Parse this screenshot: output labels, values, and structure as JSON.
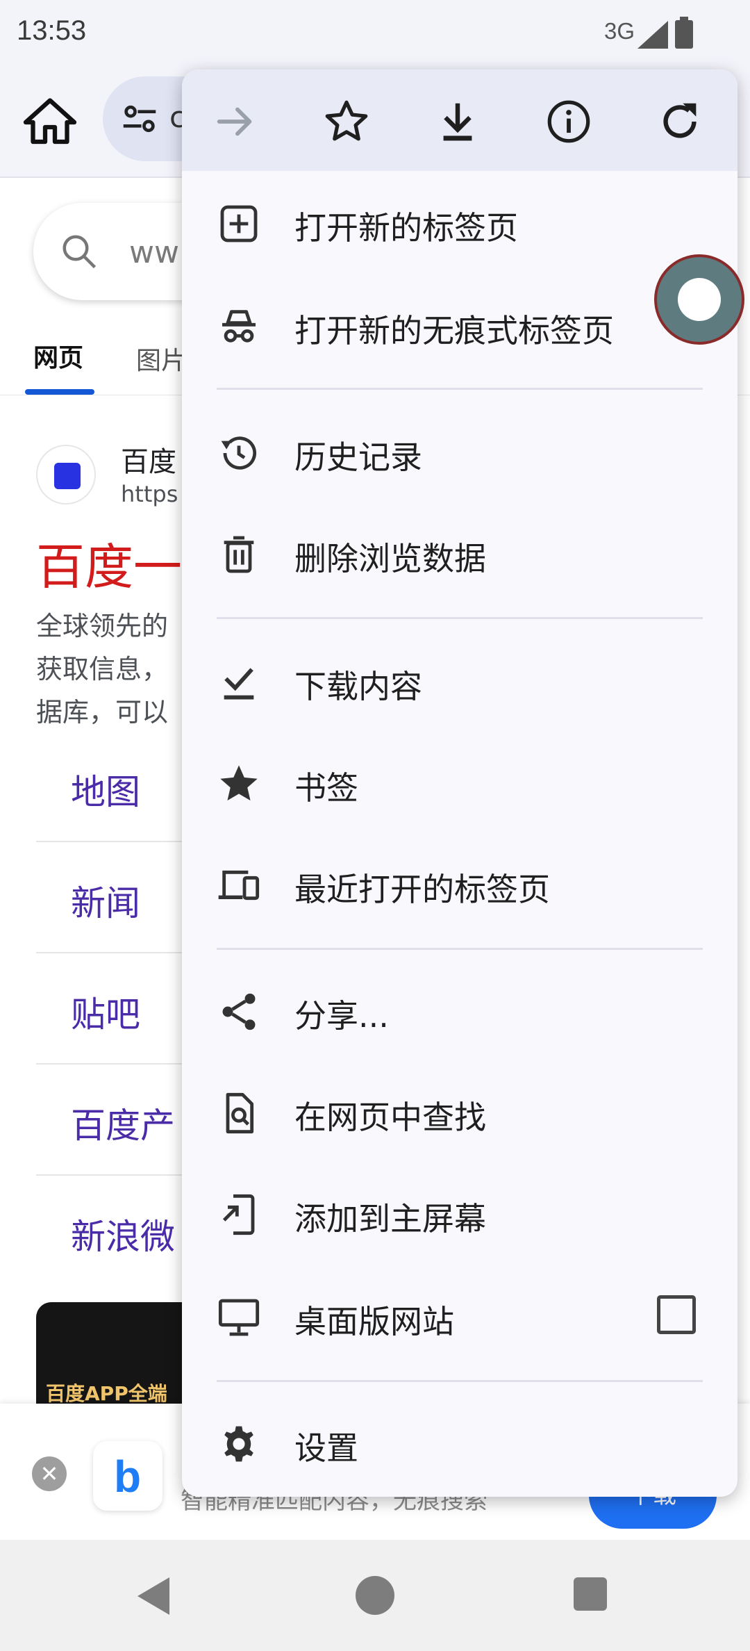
{
  "status_bar": {
    "time": "13:53",
    "network": "3G"
  },
  "toolbar": {
    "omnibox_text": "c"
  },
  "page": {
    "search_text": "ww",
    "tabs": [
      {
        "label": "网页"
      },
      {
        "label": "图片"
      }
    ],
    "result": {
      "site": "百度",
      "url": "https",
      "title": "百度一",
      "snippet_lines": [
        "全球领先的",
        "获取信息，",
        "据库，可以"
      ],
      "sitelinks": [
        "地图",
        "新闻",
        "贴吧",
        "百度产",
        "新浪微"
      ],
      "image_caption": "百度APP全端"
    },
    "banner": {
      "close_symbol": "✕",
      "logo_letter": "b",
      "text": "智能精准匹配内容，无痕搜索",
      "button": "下载"
    }
  },
  "menu": {
    "header_buttons": [
      "forward-icon",
      "bookmark-star-icon",
      "download-icon",
      "info-icon",
      "reload-icon"
    ],
    "items": [
      {
        "icon": "new-tab-icon",
        "label": "打开新的标签页"
      },
      {
        "icon": "incognito-icon",
        "label": "打开新的无痕式标签页"
      },
      {
        "icon": "history-icon",
        "label": "历史记录"
      },
      {
        "icon": "trash-icon",
        "label": "删除浏览数据"
      },
      {
        "icon": "downloads-check-icon",
        "label": "下载内容"
      },
      {
        "icon": "star-icon",
        "label": "书签"
      },
      {
        "icon": "devices-icon",
        "label": "最近打开的标签页"
      },
      {
        "icon": "share-icon",
        "label": "分享..."
      },
      {
        "icon": "find-in-page-icon",
        "label": "在网页中查找"
      },
      {
        "icon": "add-to-home-icon",
        "label": "添加到主屏幕"
      },
      {
        "icon": "desktop-icon",
        "label": "桌面版网站",
        "checked": false
      },
      {
        "icon": "gear-icon",
        "label": "设置"
      }
    ]
  },
  "colors": {
    "accent": "#1558d6",
    "title_red": "#d21b1b",
    "link_purple": "#4b2ca8",
    "menu_bg": "#f8f8fd",
    "menu_header_bg": "#e8ebf6"
  }
}
